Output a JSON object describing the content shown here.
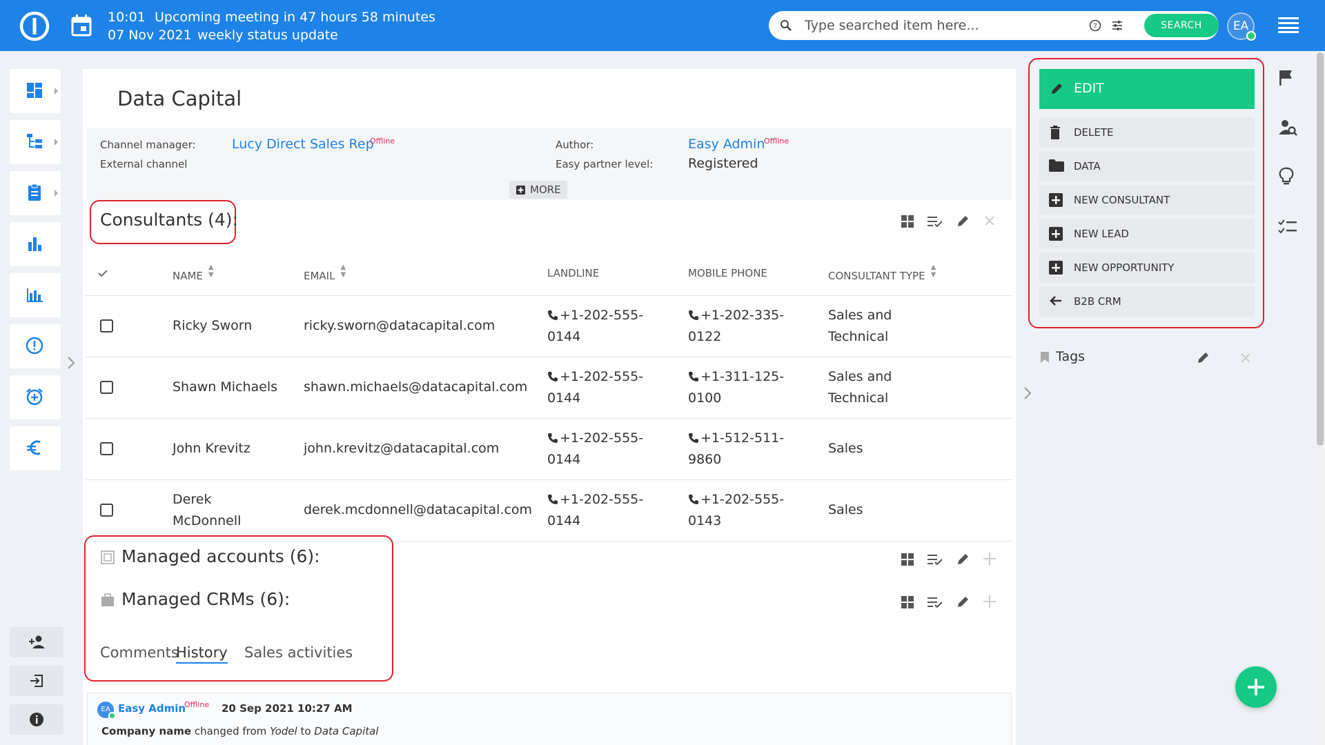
{
  "topbar": {
    "time": "10:01",
    "meeting_text": "Upcoming meeting in 47 hours 58 minutes",
    "date": "07 Nov 2021",
    "meeting_title": "weekly status update",
    "search_placeholder": "Type searched item here...",
    "search_button": "SEARCH",
    "avatar_initials": "EA",
    "accent_color": "#1e82e6",
    "button_color": "#16c984"
  },
  "sidebar": {
    "items": [
      {
        "icon": "dashboard-icon"
      },
      {
        "icon": "hierarchy-icon"
      },
      {
        "icon": "clipboard-icon"
      },
      {
        "icon": "bar-chart-icon"
      },
      {
        "icon": "column-chart-icon"
      },
      {
        "icon": "alert-circle-icon"
      },
      {
        "icon": "alarm-add-icon"
      },
      {
        "icon": "euro-icon"
      }
    ],
    "bottom": [
      {
        "icon": "add-user-icon"
      },
      {
        "icon": "exit-icon"
      },
      {
        "icon": "info-icon"
      }
    ]
  },
  "page": {
    "title": "Data Capital",
    "info": {
      "channel_manager_label": "Channel manager:",
      "channel_manager_value": "Lucy Direct Sales Rep",
      "channel_manager_status": "Offline",
      "external_channel_label": "External channel",
      "author_label": "Author:",
      "author_value": "Easy Admin",
      "author_status": "Offline",
      "partner_level_label": "Easy partner level:",
      "partner_level_value": "Registered",
      "more_label": "MORE"
    },
    "consultants": {
      "title": "Consultants (4):",
      "columns": [
        "NAME",
        "EMAIL",
        "LANDLINE",
        "MOBILE PHONE",
        "CONSULTANT TYPE"
      ],
      "rows": [
        {
          "name": "Ricky Sworn",
          "email": "ricky.sworn@datacapital.com",
          "landline_1": "+1-202-555-",
          "landline_2": "0144",
          "mobile_1": "+1-202-335-",
          "mobile_2": "0122",
          "type_1": "Sales and",
          "type_2": "Technical"
        },
        {
          "name": "Shawn Michaels",
          "email": "shawn.michaels@datacapital.com",
          "landline_1": "+1-202-555-",
          "landline_2": "0144",
          "mobile_1": "+1-311-125-",
          "mobile_2": "0100",
          "type_1": "Sales and",
          "type_2": "Technical"
        },
        {
          "name": "John Krevitz",
          "email": "john.krevitz@datacapital.com",
          "landline_1": "+1-202-555-",
          "landline_2": "0144",
          "mobile_1": "+1-512-511-",
          "mobile_2": "9860",
          "type_1": "Sales",
          "type_2": ""
        },
        {
          "name": "Derek McDonnell",
          "email": "derek.mcdonnell@datacapital.com",
          "landline_1": "+1-202-555-",
          "landline_2": "0144",
          "mobile_1": "+1-202-555-",
          "mobile_2": "0143",
          "type_1": "Sales",
          "type_2": ""
        }
      ]
    },
    "managed_accounts_title": "Managed accounts (6):",
    "managed_crms_title": "Managed CRMs (6):",
    "tabs": [
      "Comments",
      "History",
      "Sales activities"
    ],
    "active_tab": "History",
    "history": {
      "author": "Easy Admin",
      "author_initials": "EA",
      "status": "Offline",
      "timestamp": "20 Sep 2021 10:27 AM",
      "field": "Company name",
      "changed_from_text": "changed from",
      "old_value": "Yodel",
      "to_text": "to",
      "new_value": "Data Capital"
    }
  },
  "actions": {
    "edit": "EDIT",
    "items": [
      {
        "label": "DELETE",
        "icon": "trash-icon"
      },
      {
        "label": "DATA",
        "icon": "folder-icon"
      },
      {
        "label": "NEW CONSULTANT",
        "icon": "plus-box-icon"
      },
      {
        "label": "NEW LEAD",
        "icon": "plus-box-icon"
      },
      {
        "label": "NEW OPPORTUNITY",
        "icon": "plus-box-icon"
      },
      {
        "label": "B2B CRM",
        "icon": "arrow-left-icon"
      }
    ],
    "tags_label": "Tags",
    "highlight_color": "#e0222e"
  }
}
